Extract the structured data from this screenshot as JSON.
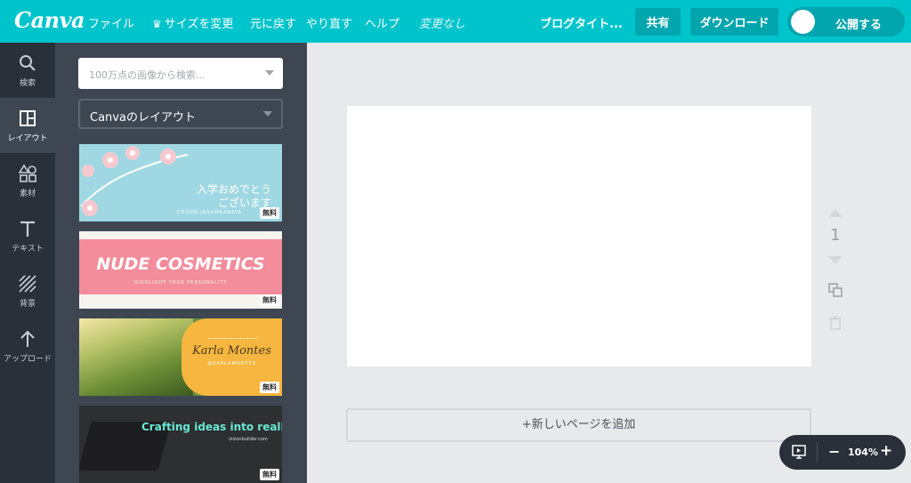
{
  "app": {
    "logo": "Canva"
  },
  "menu": {
    "file": "ファイル",
    "resize": "サイズを変更",
    "undo": "元に戻す",
    "redo": "やり直す",
    "help": "ヘルプ",
    "status": "変更なし"
  },
  "document": {
    "title": "ブログタイト..."
  },
  "actions": {
    "share": "共有",
    "download": "ダウンロード",
    "publish": "公開する"
  },
  "rail": {
    "items": [
      {
        "label": "検索",
        "icon": "search-icon"
      },
      {
        "label": "レイアウト",
        "icon": "layout-icon",
        "active": true
      },
      {
        "label": "素材",
        "icon": "elements-icon"
      },
      {
        "label": "テキスト",
        "icon": "text-icon"
      },
      {
        "label": "背景",
        "icon": "background-icon"
      },
      {
        "label": "アップロード",
        "icon": "upload-icon"
      }
    ]
  },
  "panel": {
    "search_placeholder": "100万点の画像から検索...",
    "layout_select": "Canvaのレイアウト",
    "templates": [
      {
        "line1": "入学おめでとう",
        "line2": "ございます",
        "small": "CHOON JASAMAANAYA",
        "badge": "無料"
      },
      {
        "title": "NUDE COSMETICS",
        "tagline": "HIGHLIGHT YOUR PERSONALITY",
        "badge": "無料"
      },
      {
        "name": "Karla Montes",
        "handle": "@KARLAMONTES",
        "badge": "無料"
      },
      {
        "headline": "Crafting ideas into reality",
        "site": "visionbuilder.com",
        "badge": "無料"
      }
    ]
  },
  "canvas": {
    "page_number": "1",
    "add_page": "+新しいページを追加"
  },
  "zoom": {
    "level": "104%",
    "minus": "−",
    "plus": "+"
  },
  "colors": {
    "brand": "#00c4cc",
    "rail": "#293039",
    "panel": "#3e4652"
  }
}
